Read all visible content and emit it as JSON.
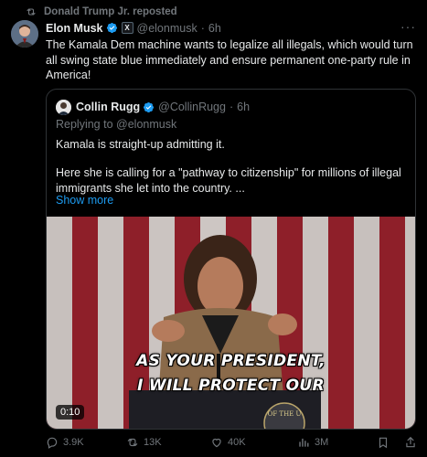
{
  "repost": {
    "text": "Donald Trump Jr. reposted",
    "icon": "repost-icon"
  },
  "tweet": {
    "author_name": "Elon Musk",
    "author_handle": "@elonmusk",
    "time": "6h",
    "separator": "·",
    "affiliate_badge": "X",
    "more": "···",
    "text": "The Kamala Dem machine wants to legalize all illegals, which would turn all swing state blue immediately and ensure permanent one-party rule in America!"
  },
  "quote": {
    "author_name": "Collin Rugg",
    "author_handle": "@CollinRugg",
    "time": "6h",
    "separator": "·",
    "replying_prefix": "Replying to",
    "replying_to": "@elonmusk",
    "text1": "Kamala is straight-up admitting it.",
    "text2": "Here she is calling for a \"pathway to citizenship\" for millions of illegal immigrants she let into the country. ...",
    "show_more": "Show more",
    "video": {
      "caption_line1": "AS YOUR PRESIDENT,",
      "caption_line2": "I WILL PROTECT OUR",
      "duration": "0:10",
      "seal_text": "OF THE U"
    }
  },
  "actions": {
    "replies": "3.9K",
    "reposts": "13K",
    "likes": "40K",
    "views": "3M"
  },
  "colors": {
    "accent": "#1d9bf0",
    "muted": "#71767b",
    "border": "#2f3336",
    "background": "#000000"
  }
}
